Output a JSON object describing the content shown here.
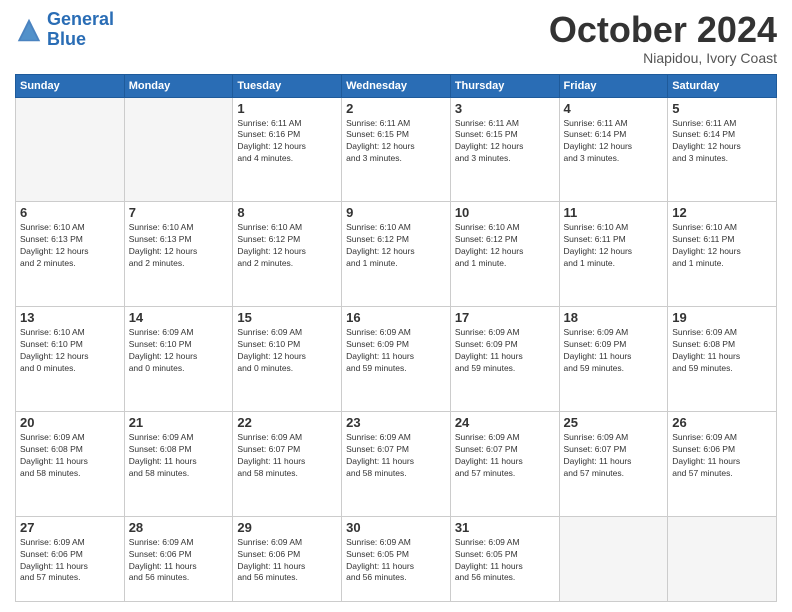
{
  "logo": {
    "line1": "General",
    "line2": "Blue"
  },
  "title": "October 2024",
  "subtitle": "Niapidou, Ivory Coast",
  "days_header": [
    "Sunday",
    "Monday",
    "Tuesday",
    "Wednesday",
    "Thursday",
    "Friday",
    "Saturday"
  ],
  "weeks": [
    [
      {
        "day": "",
        "info": ""
      },
      {
        "day": "",
        "info": ""
      },
      {
        "day": "1",
        "info": "Sunrise: 6:11 AM\nSunset: 6:16 PM\nDaylight: 12 hours\nand 4 minutes."
      },
      {
        "day": "2",
        "info": "Sunrise: 6:11 AM\nSunset: 6:15 PM\nDaylight: 12 hours\nand 3 minutes."
      },
      {
        "day": "3",
        "info": "Sunrise: 6:11 AM\nSunset: 6:15 PM\nDaylight: 12 hours\nand 3 minutes."
      },
      {
        "day": "4",
        "info": "Sunrise: 6:11 AM\nSunset: 6:14 PM\nDaylight: 12 hours\nand 3 minutes."
      },
      {
        "day": "5",
        "info": "Sunrise: 6:11 AM\nSunset: 6:14 PM\nDaylight: 12 hours\nand 3 minutes."
      }
    ],
    [
      {
        "day": "6",
        "info": "Sunrise: 6:10 AM\nSunset: 6:13 PM\nDaylight: 12 hours\nand 2 minutes."
      },
      {
        "day": "7",
        "info": "Sunrise: 6:10 AM\nSunset: 6:13 PM\nDaylight: 12 hours\nand 2 minutes."
      },
      {
        "day": "8",
        "info": "Sunrise: 6:10 AM\nSunset: 6:12 PM\nDaylight: 12 hours\nand 2 minutes."
      },
      {
        "day": "9",
        "info": "Sunrise: 6:10 AM\nSunset: 6:12 PM\nDaylight: 12 hours\nand 1 minute."
      },
      {
        "day": "10",
        "info": "Sunrise: 6:10 AM\nSunset: 6:12 PM\nDaylight: 12 hours\nand 1 minute."
      },
      {
        "day": "11",
        "info": "Sunrise: 6:10 AM\nSunset: 6:11 PM\nDaylight: 12 hours\nand 1 minute."
      },
      {
        "day": "12",
        "info": "Sunrise: 6:10 AM\nSunset: 6:11 PM\nDaylight: 12 hours\nand 1 minute."
      }
    ],
    [
      {
        "day": "13",
        "info": "Sunrise: 6:10 AM\nSunset: 6:10 PM\nDaylight: 12 hours\nand 0 minutes."
      },
      {
        "day": "14",
        "info": "Sunrise: 6:09 AM\nSunset: 6:10 PM\nDaylight: 12 hours\nand 0 minutes."
      },
      {
        "day": "15",
        "info": "Sunrise: 6:09 AM\nSunset: 6:10 PM\nDaylight: 12 hours\nand 0 minutes."
      },
      {
        "day": "16",
        "info": "Sunrise: 6:09 AM\nSunset: 6:09 PM\nDaylight: 11 hours\nand 59 minutes."
      },
      {
        "day": "17",
        "info": "Sunrise: 6:09 AM\nSunset: 6:09 PM\nDaylight: 11 hours\nand 59 minutes."
      },
      {
        "day": "18",
        "info": "Sunrise: 6:09 AM\nSunset: 6:09 PM\nDaylight: 11 hours\nand 59 minutes."
      },
      {
        "day": "19",
        "info": "Sunrise: 6:09 AM\nSunset: 6:08 PM\nDaylight: 11 hours\nand 59 minutes."
      }
    ],
    [
      {
        "day": "20",
        "info": "Sunrise: 6:09 AM\nSunset: 6:08 PM\nDaylight: 11 hours\nand 58 minutes."
      },
      {
        "day": "21",
        "info": "Sunrise: 6:09 AM\nSunset: 6:08 PM\nDaylight: 11 hours\nand 58 minutes."
      },
      {
        "day": "22",
        "info": "Sunrise: 6:09 AM\nSunset: 6:07 PM\nDaylight: 11 hours\nand 58 minutes."
      },
      {
        "day": "23",
        "info": "Sunrise: 6:09 AM\nSunset: 6:07 PM\nDaylight: 11 hours\nand 58 minutes."
      },
      {
        "day": "24",
        "info": "Sunrise: 6:09 AM\nSunset: 6:07 PM\nDaylight: 11 hours\nand 57 minutes."
      },
      {
        "day": "25",
        "info": "Sunrise: 6:09 AM\nSunset: 6:07 PM\nDaylight: 11 hours\nand 57 minutes."
      },
      {
        "day": "26",
        "info": "Sunrise: 6:09 AM\nSunset: 6:06 PM\nDaylight: 11 hours\nand 57 minutes."
      }
    ],
    [
      {
        "day": "27",
        "info": "Sunrise: 6:09 AM\nSunset: 6:06 PM\nDaylight: 11 hours\nand 57 minutes."
      },
      {
        "day": "28",
        "info": "Sunrise: 6:09 AM\nSunset: 6:06 PM\nDaylight: 11 hours\nand 56 minutes."
      },
      {
        "day": "29",
        "info": "Sunrise: 6:09 AM\nSunset: 6:06 PM\nDaylight: 11 hours\nand 56 minutes."
      },
      {
        "day": "30",
        "info": "Sunrise: 6:09 AM\nSunset: 6:05 PM\nDaylight: 11 hours\nand 56 minutes."
      },
      {
        "day": "31",
        "info": "Sunrise: 6:09 AM\nSunset: 6:05 PM\nDaylight: 11 hours\nand 56 minutes."
      },
      {
        "day": "",
        "info": ""
      },
      {
        "day": "",
        "info": ""
      }
    ]
  ]
}
